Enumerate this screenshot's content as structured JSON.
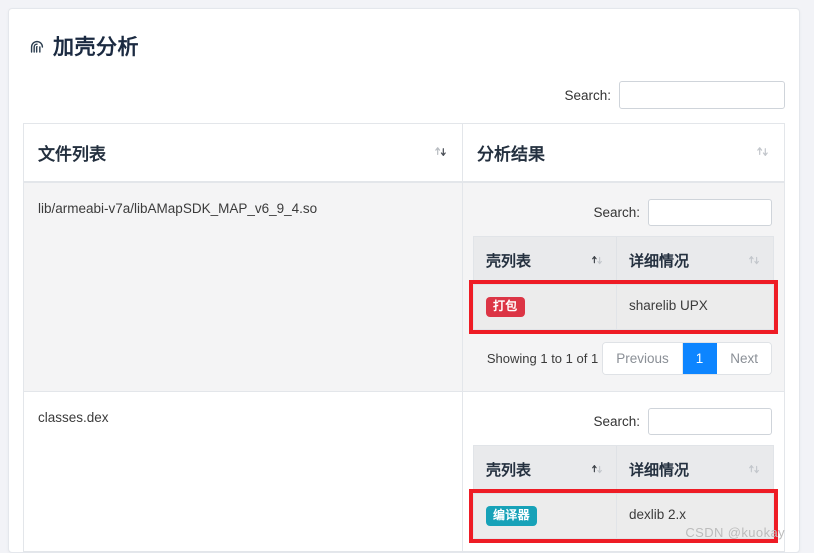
{
  "panel": {
    "title": "加壳分析",
    "icon": "fingerprint-icon"
  },
  "outer_search": {
    "label": "Search:",
    "value": "",
    "placeholder": ""
  },
  "outer_table": {
    "columns": [
      {
        "label": "文件列表",
        "sort_icon": "sort-both-icon"
      },
      {
        "label": "分析结果",
        "sort_icon": "sort-both-icon"
      }
    ],
    "rows": [
      {
        "file": "lib/armeabi-v7a/libAMapSDK_MAP_v6_9_4.so",
        "result": {
          "search": {
            "label": "Search:",
            "value": "",
            "placeholder": ""
          },
          "columns": [
            {
              "label": "壳列表",
              "sort_icon": "sort-asc-icon"
            },
            {
              "label": "详细情况",
              "sort_icon": "sort-both-icon"
            }
          ],
          "rows": [
            {
              "badge": "打包",
              "badge_color": "#dc3545",
              "detail": "sharelib UPX",
              "highlighted": true
            }
          ],
          "pagination": {
            "info": "Showing 1 to 1 of 1",
            "previous": "Previous",
            "page": "1",
            "next": "Next",
            "active_color": "#0d85ff"
          }
        }
      },
      {
        "file": "classes.dex",
        "result": {
          "search": {
            "label": "Search:",
            "value": "",
            "placeholder": ""
          },
          "columns": [
            {
              "label": "壳列表",
              "sort_icon": "sort-asc-icon"
            },
            {
              "label": "详细情况",
              "sort_icon": "sort-both-icon"
            }
          ],
          "rows": [
            {
              "badge": "编译器",
              "badge_color": "#17a2b8",
              "detail": "dexlib 2.x",
              "highlighted": true
            }
          ]
        }
      }
    ]
  },
  "watermark": "CSDN @kuokay"
}
